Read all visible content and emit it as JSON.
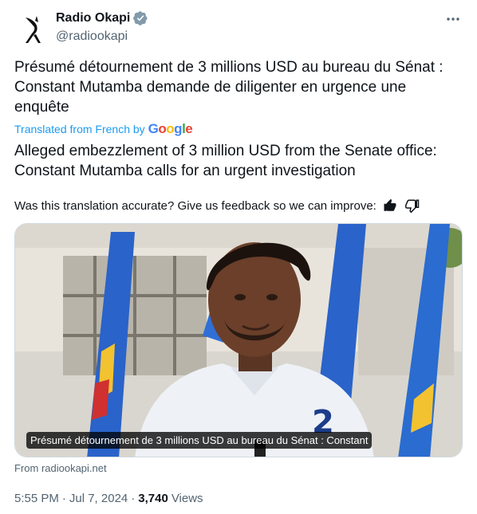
{
  "author": {
    "display_name": "Radio Okapi",
    "handle": "@radiookapi",
    "verified": true
  },
  "post": {
    "original_text": "Présumé détournement de 3 millions USD au bureau du Sénat : Constant Mutamba demande de diligenter en urgence une enquête",
    "translated_from": "Translated from French by",
    "translator_brand": "Google",
    "translation_text": "Alleged embezzlement of 3 million USD from the Senate office: Constant Mutamba calls for an urgent investigation",
    "feedback_prompt": "Was this translation accurate? Give us feedback so we can improve:",
    "media_caption": "Présumé détournement de 3 millions USD au bureau du Sénat : Constant",
    "source_link": "From radiookapi.net",
    "time": "5:55 PM",
    "date": "Jul 7, 2024",
    "separator": "·",
    "views_count": "3,740",
    "views_label": "Views"
  },
  "icons": {
    "more": "more-options-icon",
    "verified": "verified-badge-icon",
    "thumbs_up": "thumbs-up-icon",
    "thumbs_down": "thumbs-down-icon"
  },
  "colors": {
    "text_primary": "#0f1419",
    "text_secondary": "#536471",
    "link_blue": "#1d9bf0",
    "verified_gray": "#829aab"
  }
}
